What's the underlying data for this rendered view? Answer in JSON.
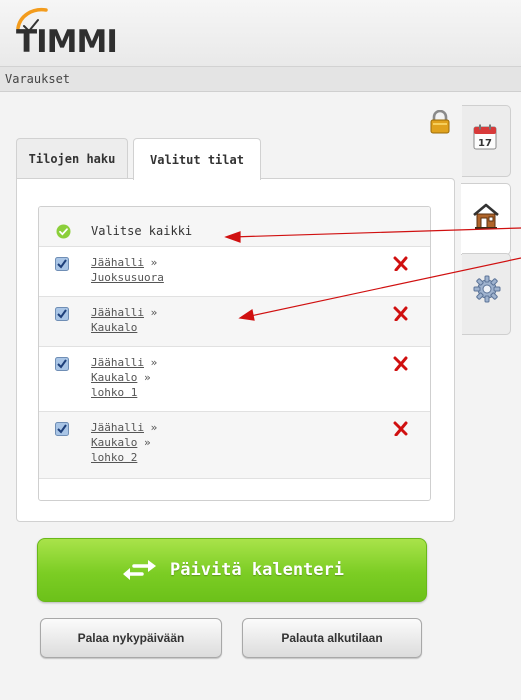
{
  "app": {
    "logo_text": "TIMMI"
  },
  "subbar": {
    "label": "Varaukset"
  },
  "tabs": [
    {
      "label": "Tilojen haku",
      "active": false
    },
    {
      "label": "Valitut tilat",
      "active": true
    }
  ],
  "select_all": {
    "label": "Valitse kaikki"
  },
  "items": [
    {
      "parts": [
        "Jäähalli",
        "Juoksusuora"
      ],
      "checked": true
    },
    {
      "parts": [
        "Jäähalli",
        "Kaukalo"
      ],
      "checked": true
    },
    {
      "parts": [
        "Jäähalli",
        "Kaukalo",
        "lohko 1"
      ],
      "checked": true
    },
    {
      "parts": [
        "Jäähalli",
        "Kaukalo",
        "lohko 2"
      ],
      "checked": true
    }
  ],
  "separator": "»",
  "buttons": {
    "update": "Päivitä kalenteri",
    "today": "Palaa nykypäivään",
    "reset": "Palauta alkutilaan"
  },
  "side_tabs": [
    {
      "icon": "calendar-icon",
      "text": "17"
    },
    {
      "icon": "house-icon"
    },
    {
      "icon": "gear-icon"
    }
  ],
  "colors": {
    "accent_green": "#7ccd24",
    "remove_red": "#d01010",
    "annotation_red": "#d01010",
    "logo_orange": "#f39c1d"
  }
}
